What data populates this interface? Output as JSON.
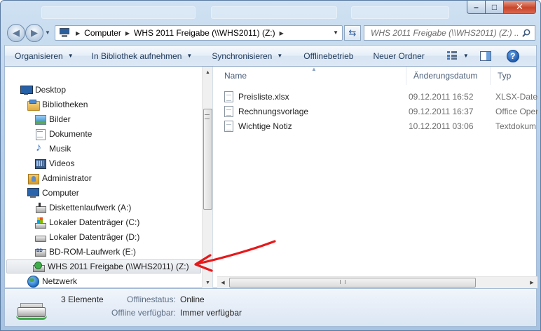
{
  "window": {
    "caption_buttons": {
      "minimize": "–",
      "maximize": "□",
      "close": "✕"
    }
  },
  "nav": {
    "back_icon": "arrow-left-icon",
    "forward_icon": "arrow-right-icon",
    "breadcrumb": [
      "Computer",
      "WHS 2011 Freigabe (\\\\WHS2011) (Z:)"
    ],
    "search_placeholder": "WHS 2011 Freigabe (\\\\WHS2011) (Z:) ..."
  },
  "toolbar": {
    "organize": "Organisieren",
    "include_library": "In Bibliothek aufnehmen",
    "sync": "Synchronisieren",
    "offline": "Offlinebetrieb",
    "new_folder": "Neuer Ordner",
    "help": "?"
  },
  "tree": [
    {
      "label": "Desktop",
      "icon": "desktop-icon"
    },
    {
      "label": "Bibliotheken",
      "icon": "library-icon"
    },
    {
      "label": "Bilder",
      "icon": "pictures-icon"
    },
    {
      "label": "Dokumente",
      "icon": "documents-icon"
    },
    {
      "label": "Musik",
      "icon": "music-icon"
    },
    {
      "label": "Videos",
      "icon": "videos-icon"
    },
    {
      "label": "Administrator",
      "icon": "user-folder-icon"
    },
    {
      "label": "Computer",
      "icon": "computer-icon"
    },
    {
      "label": "Diskettenlaufwerk (A:)",
      "icon": "floppy-drive-icon"
    },
    {
      "label": "Lokaler Datenträger (C:)",
      "icon": "system-drive-icon"
    },
    {
      "label": "Lokaler Datenträger (D:)",
      "icon": "hard-drive-icon"
    },
    {
      "label": "BD-ROM-Laufwerk (E:)",
      "icon": "bd-rom-drive-icon"
    },
    {
      "label": "WHS 2011 Freigabe (\\\\WHS2011) (Z:)",
      "icon": "network-drive-icon",
      "selected": true
    },
    {
      "label": "Netzwerk",
      "icon": "network-icon"
    }
  ],
  "columns": {
    "name": "Name",
    "date": "Änderungsdatum",
    "type": "Typ"
  },
  "files": [
    {
      "name": "Preisliste.xlsx",
      "date": "09.12.2011 16:52",
      "type": "XLSX-Datei"
    },
    {
      "name": "Rechnungsvorlage",
      "date": "09.12.2011 16:37",
      "type": "Office Oper"
    },
    {
      "name": "Wichtige Notiz",
      "date": "10.12.2011 03:06",
      "type": "Textdokum"
    }
  ],
  "details": {
    "count": "3 Elemente",
    "offline_status_label": "Offlinestatus:",
    "offline_status_value": "Online",
    "offline_avail_label": "Offline verfügbar:",
    "offline_avail_value": "Immer verfügbar"
  },
  "colors": {
    "annotation_arrow": "#e8181a",
    "selection_bg": "#e6e9ee"
  }
}
